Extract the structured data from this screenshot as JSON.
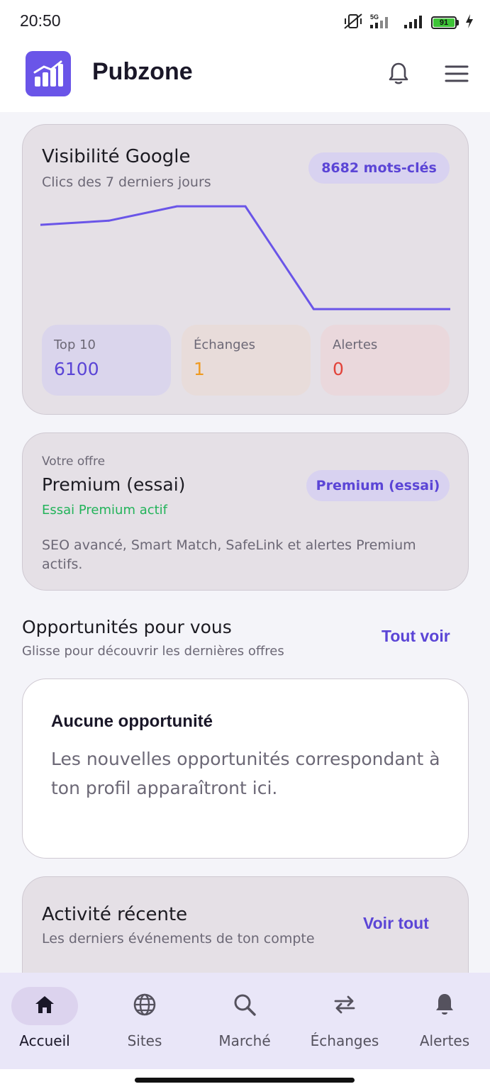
{
  "status_bar": {
    "time": "20:50",
    "battery": "91",
    "icons": [
      "vibrate-off-icon",
      "signal-5g-icon",
      "signal-icon",
      "battery-icon",
      "charging-icon"
    ]
  },
  "header": {
    "app_name": "Pubzone",
    "icons": [
      "logo-chart-icon",
      "bell-icon",
      "menu-icon"
    ]
  },
  "visibility": {
    "title": "Visibilité Google",
    "subtitle": "Clics des 7 derniers jours",
    "keywords_badge": "8682 mots-clés",
    "stats": [
      {
        "label": "Top 10",
        "value": "6100",
        "color": "#5b45d6"
      },
      {
        "label": "Échanges",
        "value": "1",
        "color": "#ef9a21"
      },
      {
        "label": "Alertes",
        "value": "0",
        "color": "#e2433a"
      }
    ]
  },
  "chart_data": {
    "type": "line",
    "x": [
      1,
      2,
      3,
      4,
      5,
      6,
      7
    ],
    "series": [
      {
        "values": [
          0.82,
          0.86,
          1.0,
          1.0,
          0.0,
          0.0,
          0.0
        ],
        "color": "#6a55e8"
      }
    ],
    "ylim": [
      0,
      1
    ],
    "grid": false
  },
  "offer": {
    "label": "Votre offre",
    "name": "Premium (essai)",
    "status": "Essai Premium actif",
    "badge": "Premium (essai)",
    "description": "SEO avancé, Smart Match, SafeLink et alertes Premium actifs."
  },
  "opportunities": {
    "title": "Opportunités pour vous",
    "subtitle": "Glisse pour découvrir les dernières offres",
    "link": "Tout voir",
    "empty_title": "Aucune opportunité",
    "empty_text": "Les nouvelles opportunités correspondant à ton profil apparaîtront ici."
  },
  "activity": {
    "title": "Activité récente",
    "subtitle": "Les derniers événements de ton compte",
    "link": "Voir tout"
  },
  "nav": {
    "items": [
      {
        "label": "Accueil",
        "icon": "home-icon",
        "active": true
      },
      {
        "label": "Sites",
        "icon": "globe-icon",
        "active": false
      },
      {
        "label": "Marché",
        "icon": "search-icon",
        "active": false
      },
      {
        "label": "Échanges",
        "icon": "swap-icon",
        "active": false
      },
      {
        "label": "Alertes",
        "icon": "bell-icon",
        "active": false
      }
    ]
  },
  "colors": {
    "accent": "#5b45d6",
    "logo": "#6a55e8",
    "success": "#22b35a"
  }
}
